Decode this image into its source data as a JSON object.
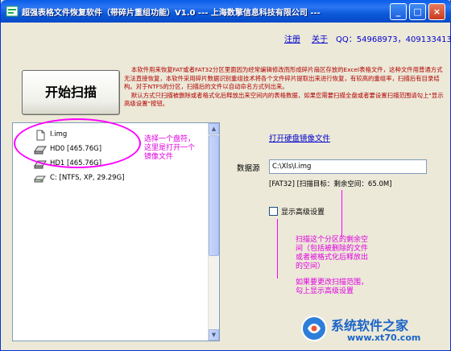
{
  "window": {
    "title": "超强表格文件恢复软件（带碎片重组功能）V1.0 --- 上海数擎信息科技有限公司 ---",
    "minimize": "_",
    "maximize": "□",
    "close": "×"
  },
  "toplinks": {
    "register": "注册",
    "about": "关于",
    "qq": "QQ：54968973，409133413"
  },
  "scan_button": "开始扫描",
  "description": {
    "p1": "本软件用来恢复FAT或者FAT32分区里面因为经常编辑修改而形成碎片扇区存放的Excel表格文件，这种文件用普通方式无法直接恢复，本软件采用碎片数据识别重组技术将各个文件碎片提取出来进行恢复，有较高的重组率，扫描后有目录结构。对于NTFS的分区，扫描后的文件以自动命名方式列出来。",
    "p2": "默认方式只扫描被删除或者格式化后释放出来空间内的表格数据，如果您需要扫描全盘或者要设置扫描范围请勾上\"显示高级设置\"按钮。"
  },
  "tree": {
    "items": [
      {
        "label": "I.img"
      },
      {
        "label": "HD0  [465.76G]"
      },
      {
        "label": "HD1  [465.76G]"
      },
      {
        "label": "C:  [NTFS, XP, 29.29G]"
      }
    ]
  },
  "annotations": {
    "tree_note": "选择一个盘符，\n这里是打开一个\n镜像文件",
    "partition_note": "扫描这个分区的剩余空\n间（包括被删除的文件\n或者被格式化后释放出\n的空间）",
    "advanced_note": "如果要更改扫描范围，\n勾上显示高级设置"
  },
  "right_panel": {
    "open_image_link": "打开硬盘镜像文件",
    "source_label": "数据源",
    "source_value": "C:\\Xls\\I.img",
    "scan_info": "[FAT32] [扫描目标：剩余空间：65.0M]",
    "advanced_checkbox_label": "显示高级设置",
    "advanced_checked": false
  },
  "watermark": {
    "name": "系统软件之家",
    "url": "www.xt70.com"
  }
}
